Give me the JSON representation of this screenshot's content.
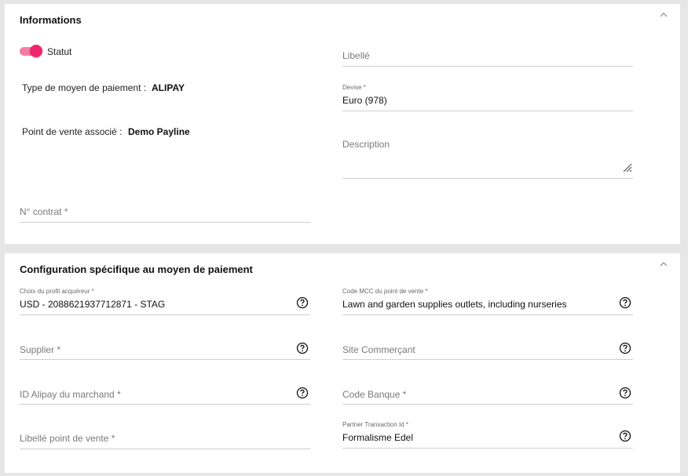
{
  "informations": {
    "title": "Informations",
    "statut_label": "Statut",
    "type_label": "Type de moyen de paiement :",
    "type_value": "ALIPAY",
    "pos_label": "Point de vente associé :",
    "pos_value": "Demo Payline",
    "contrat_placeholder": "N° contrat *",
    "libelle_placeholder": "Libellé",
    "devise_label": "Devise *",
    "devise_value": "Euro (978)",
    "description_placeholder": "Description"
  },
  "config": {
    "title": "Configuration spécifique au moyen de paiement",
    "profil_label": "Choix du profil acquéreur *",
    "profil_value": "USD - 2088621937712871 - STAG",
    "mcc_label": "Code MCC du point de vente *",
    "mcc_value": "Lawn and garden supplies outlets, including nurseries",
    "supplier_placeholder": "Supplier *",
    "site_placeholder": "Site Commerçant",
    "alipay_id_placeholder": "ID Alipay du marchand *",
    "code_banque_placeholder": "Code Banque *",
    "libelle_pv_placeholder": "Libellé point de vente *",
    "partner_label": "Partner Transaction Id *",
    "partner_value": "Formalisme Edel"
  },
  "colors": {
    "accent": "#f0256c",
    "accent_track": "#f47da6"
  },
  "icons": {
    "collapse": "chevron-up-icon",
    "help": "question-circle-icon",
    "resize": "resize-handle-icon"
  }
}
